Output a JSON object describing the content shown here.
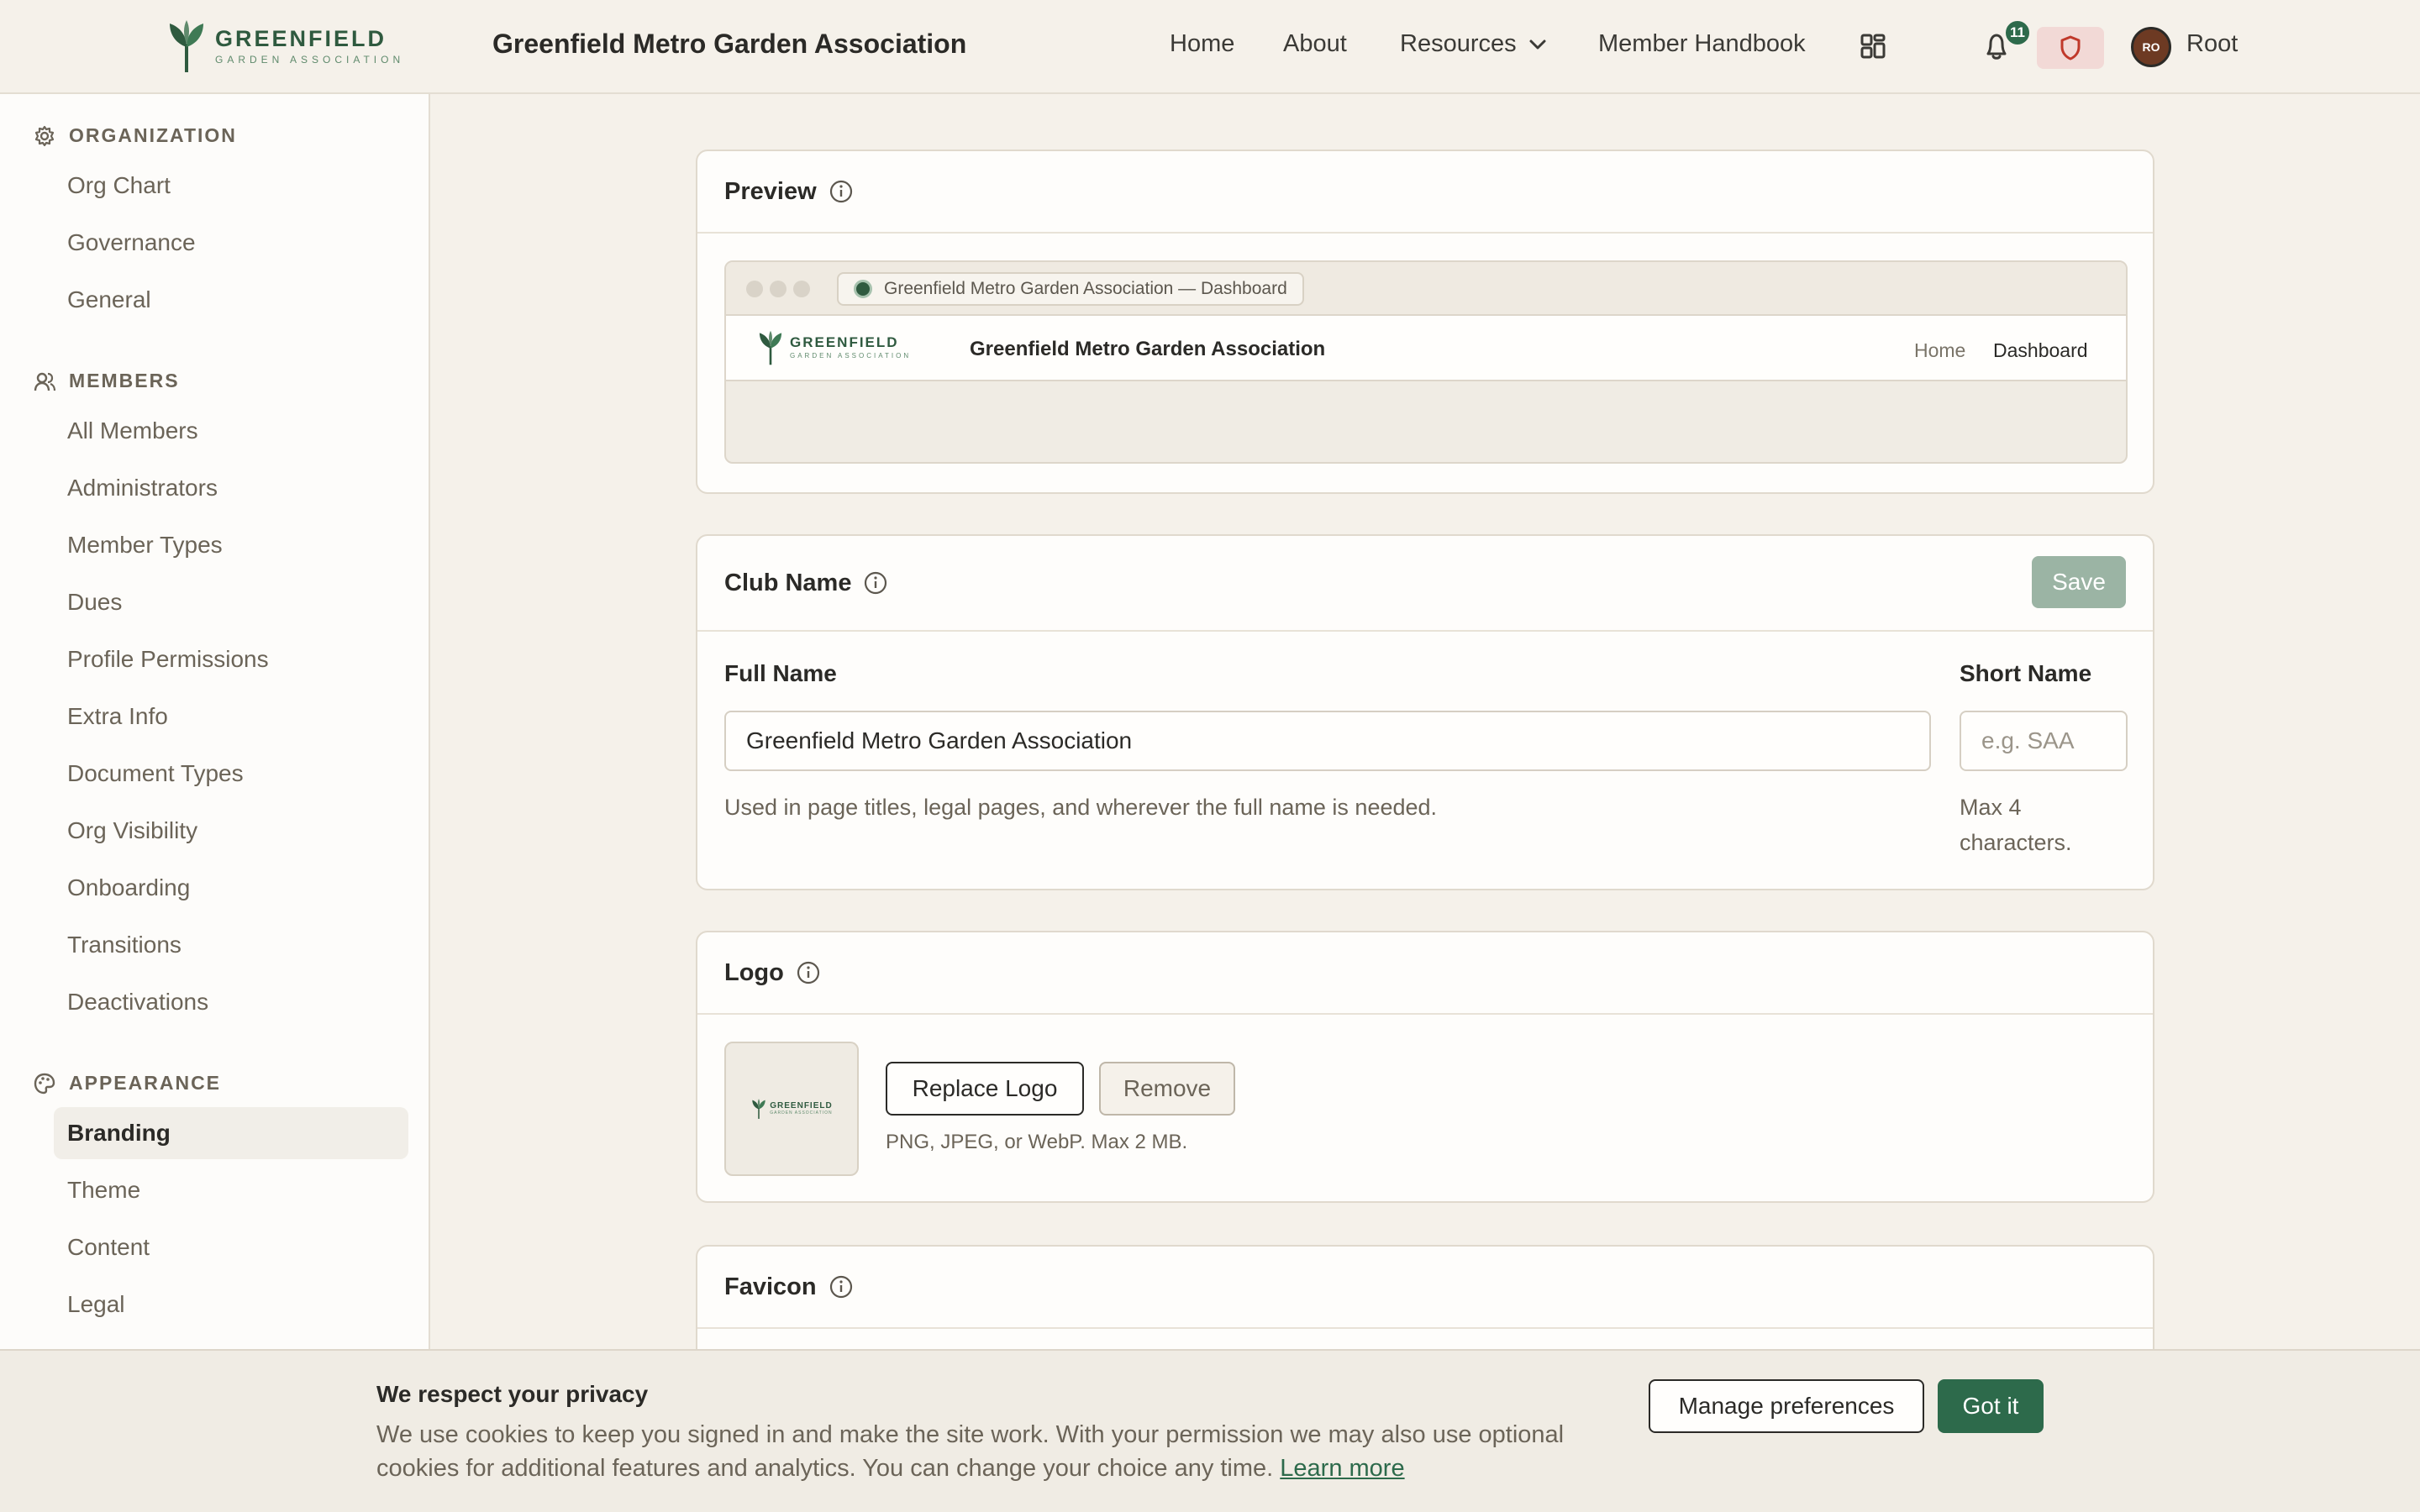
{
  "header": {
    "brand_word": "GREENFIELD",
    "brand_sub": "GARDEN ASSOCIATION",
    "org_title": "Greenfield Metro Garden Association",
    "nav": {
      "home": "Home",
      "about": "About",
      "resources": "Resources",
      "handbook": "Member Handbook"
    },
    "notification_count": "11",
    "avatar_initials": "RO",
    "user_name": "Root"
  },
  "sidebar": {
    "sections": [
      {
        "title": "ORGANIZATION",
        "icon": "gear-icon",
        "items": [
          "Org Chart",
          "Governance",
          "General"
        ]
      },
      {
        "title": "MEMBERS",
        "icon": "users-icon",
        "items": [
          "All Members",
          "Administrators",
          "Member Types",
          "Dues",
          "Profile Permissions",
          "Extra Info",
          "Document Types",
          "Org Visibility",
          "Onboarding",
          "Transitions",
          "Deactivations"
        ]
      },
      {
        "title": "APPEARANCE",
        "icon": "palette-icon",
        "items": [
          "Branding",
          "Theme",
          "Content",
          "Legal"
        ]
      }
    ],
    "active_item": "Branding"
  },
  "preview": {
    "title": "Preview",
    "tab_text": "Greenfield Metro Garden Association — Dashboard",
    "logo_word": "GREENFIELD",
    "logo_sub": "GARDEN ASSOCIATION",
    "site_title": "Greenfield Metro Garden Association",
    "nav_home": "Home",
    "nav_dashboard": "Dashboard"
  },
  "club_name": {
    "title": "Club Name",
    "save_label": "Save",
    "full_name_label": "Full Name",
    "full_name_value": "Greenfield Metro Garden Association",
    "full_name_help": "Used in page titles, legal pages, and wherever the full name is needed.",
    "short_name_label": "Short Name",
    "short_name_placeholder": "e.g. SAA",
    "short_name_help_1": "Max 4",
    "short_name_help_2": "characters."
  },
  "logo": {
    "title": "Logo",
    "replace_label": "Replace Logo",
    "remove_label": "Remove",
    "help": "PNG, JPEG, or WebP. Max 2 MB.",
    "thumb_word": "GREENFIELD",
    "thumb_sub": "GARDEN ASSOCIATION"
  },
  "favicon": {
    "title": "Favicon"
  },
  "cookie": {
    "title": "We respect your privacy",
    "body": "We use cookies to keep you signed in and make the site work. With your permission we may also use optional cookies for additional features and analytics. You can change your choice any time.",
    "link": "Learn more",
    "prefs_label": "Manage preferences",
    "accept_label": "Got it"
  },
  "colors": {
    "accent": "#2d6a4b",
    "background": "#f5f1ea",
    "sidebar": "#fdfcfa",
    "save_disabled": "#9bb4a4",
    "shield_bg": "#f2d9d6"
  }
}
